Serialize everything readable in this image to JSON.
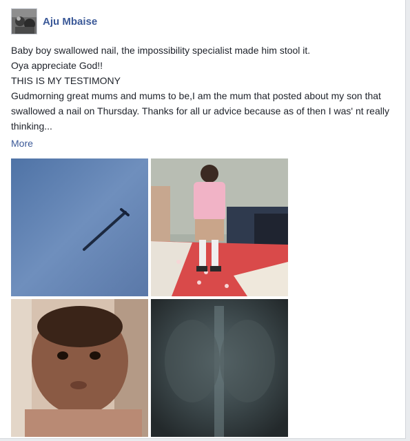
{
  "post": {
    "author": "Aju Mbaise",
    "lines": [
      "Baby boy swallowed nail, the impossibility specialist made him stool it.",
      "Oya appreciate God!!",
      "THIS IS MY TESTIMONY",
      "Gudmorning great mums and mums to be,I  am the mum that posted about my son that swallowed a nail on Thursday. Thanks for all  ur advice because as of then I was' nt really thinking..."
    ],
    "more_label": "More"
  },
  "colors": {
    "author": "#3b5998",
    "link": "#3b5998",
    "text": "#1d2129"
  }
}
